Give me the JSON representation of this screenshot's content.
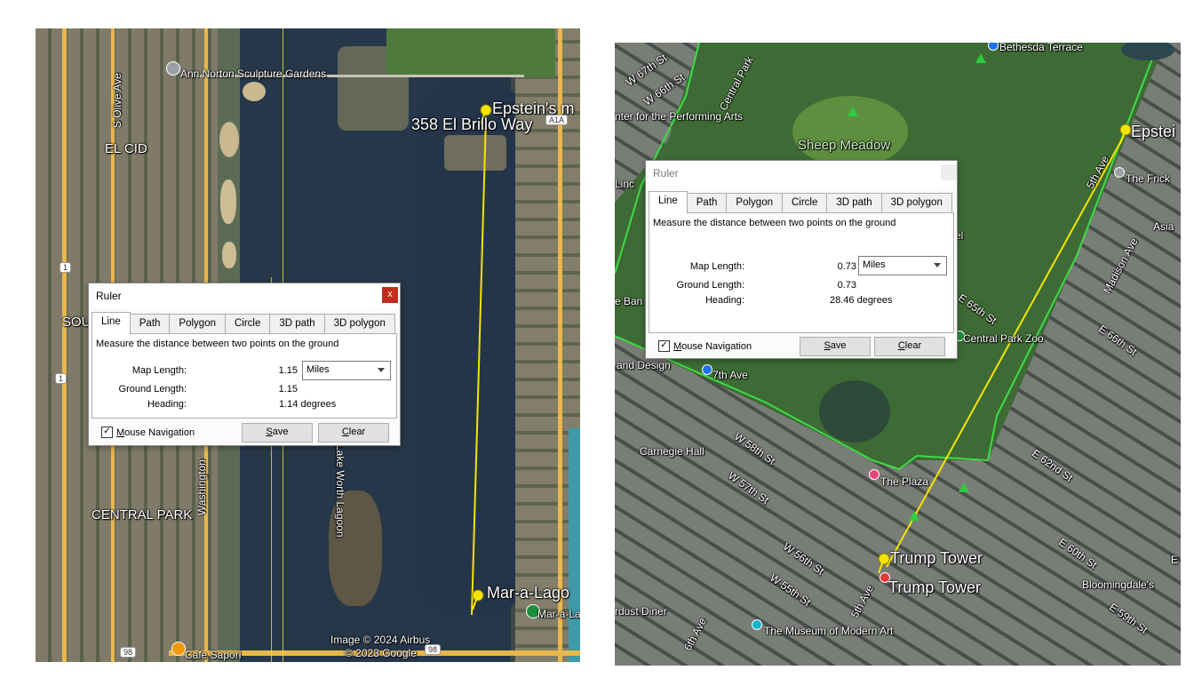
{
  "left": {
    "map_labels": {
      "sculpture_gardens": "Ann Norton Sculpture Gardens",
      "olive_ave": "S Olive Ave",
      "el_cid": "EL CID",
      "epstein": "Epstein's m",
      "el_brillo": "358 El Brillo Way",
      "south": "SOU",
      "washington": "Washington",
      "central_park": "CENTRAL PARK",
      "lake_worth": "Lake Worth Lagoon",
      "mar_a_lago": "Mar-a-Lago",
      "mar_a_lago_small": "Mar-a-La",
      "cafe": "Cafe Sapori",
      "image_credit": "Image © 2024 Airbus",
      "copyright": "© 2023 Google",
      "a1a": "A1A",
      "route_1a": "1",
      "route_1b": "1",
      "route_98a": "98",
      "route_98b": "98"
    },
    "ruler": {
      "title": "Ruler",
      "close": "x",
      "tabs": [
        "Line",
        "Path",
        "Polygon",
        "Circle",
        "3D path",
        "3D polygon"
      ],
      "description": "Measure the distance between two points on the ground",
      "map_length_label": "Map Length:",
      "map_length": "1.15",
      "unit": "Miles",
      "ground_length_label": "Ground Length:",
      "ground_length": "1.15",
      "heading_label": "Heading:",
      "heading": "1.14 degrees",
      "checkbox_mark": "✓",
      "mouse_nav_key": "M",
      "mouse_nav_rest": "ouse Navigation",
      "save_key": "S",
      "save_rest": "ave",
      "clear_key": "C",
      "clear_rest": "lear"
    }
  },
  "right": {
    "map_labels": {
      "bethesda": "Bethesda Terrace",
      "w67": "W 67th St",
      "w66": "W 66th St",
      "central_park_w": "Central Park",
      "performing_arts": "nter for the Performing Arts",
      "sheep_meadow": "Sheep Meadow",
      "linc": "Linc",
      "epstein": "Epstei",
      "frick": "The Frick",
      "fifth_ave": "5th Ave",
      "madison": "Madison Ave",
      "asia": "Asia",
      "el": "el",
      "ban": "e Ban",
      "e65": "E 65th St",
      "e66": "E 66th St",
      "zoo": "Central Park Zoo",
      "and_design": "and Design",
      "seventh_ave": "7th Ave",
      "w58": "W 58th St",
      "carnegie": "Carnegie Hall",
      "w57": "W 57th St",
      "plaza": "The Plaza",
      "e62": "E 62nd St",
      "e60": "E 60th St",
      "w56": "W 56th St",
      "w55": "W 55th St",
      "fifth_ave2": "5th Ave",
      "trump1": "Trump Tower",
      "trump2": "Trump Tower",
      "bloomingdales": "Bloomingdale's",
      "e59": "E 59th St",
      "diner": "rdust Diner",
      "sixth_ave": "6th Ave",
      "moma": "The Museum of Modern Art",
      "e_edge": "E"
    },
    "ruler": {
      "title": "Ruler",
      "tabs": [
        "Line",
        "Path",
        "Polygon",
        "Circle",
        "3D path",
        "3D polygon"
      ],
      "description": "Measure the distance between two points on the ground",
      "map_length_label": "Map Length:",
      "map_length": "0.73",
      "unit": "Miles",
      "ground_length_label": "Ground Length:",
      "ground_length": "0.73",
      "heading_label": "Heading:",
      "heading": "28.46 degrees",
      "checkbox_mark": "✓",
      "mouse_nav_key": "M",
      "mouse_nav_rest": "ouse Navigation",
      "save_key": "S",
      "save_rest": "ave",
      "clear_key": "C",
      "clear_rest": "lear"
    }
  },
  "colors": {
    "measure_line": "#f5e400",
    "close_button": "#c42b1c",
    "park_boundary": "#3ddc47"
  }
}
